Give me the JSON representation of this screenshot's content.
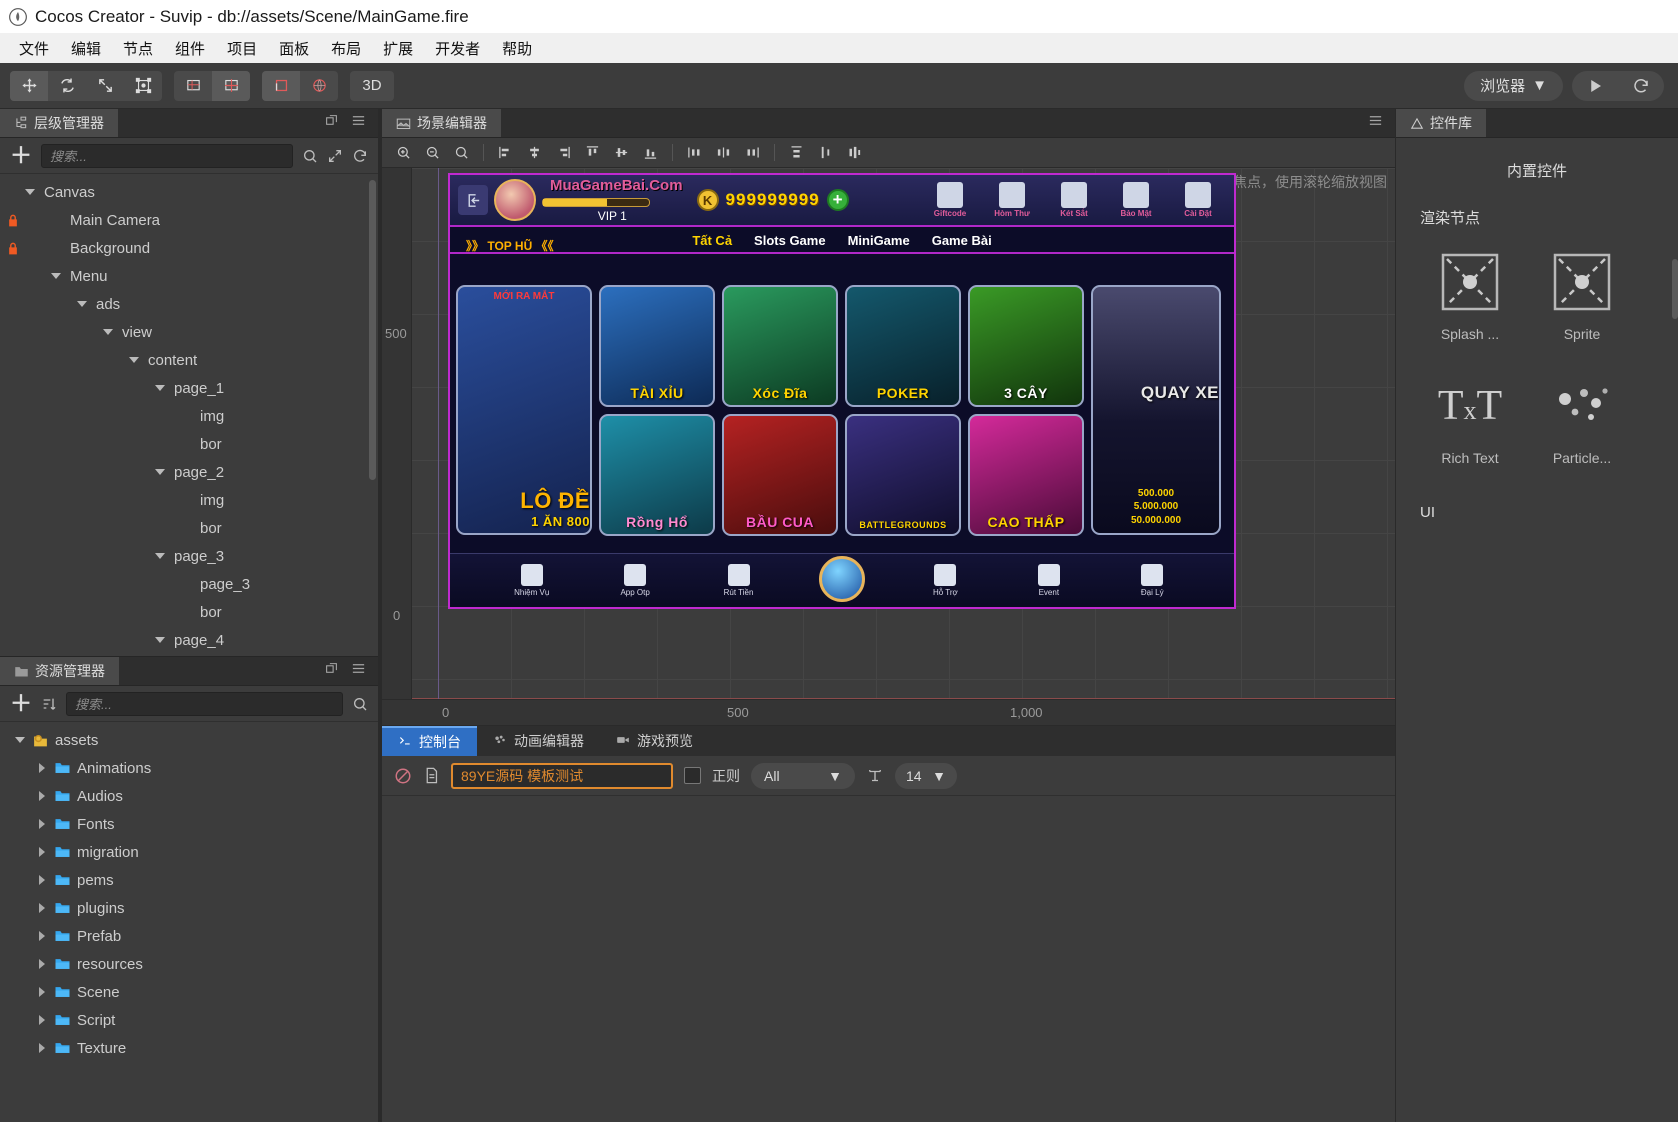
{
  "window": {
    "title": "Cocos Creator - Suvip - db://assets/Scene/MainGame.fire",
    "logo_icon": "cocos-logo-icon"
  },
  "menubar": {
    "items": [
      {
        "label": "文件",
        "name": "menu-file"
      },
      {
        "label": "编辑",
        "name": "menu-edit"
      },
      {
        "label": "节点",
        "name": "menu-node"
      },
      {
        "label": "组件",
        "name": "menu-component"
      },
      {
        "label": "项目",
        "name": "menu-project"
      },
      {
        "label": "面板",
        "name": "menu-panel"
      },
      {
        "label": "布局",
        "name": "menu-layout"
      },
      {
        "label": "扩展",
        "name": "menu-extension"
      },
      {
        "label": "开发者",
        "name": "menu-developer"
      },
      {
        "label": "帮助",
        "name": "menu-help"
      }
    ]
  },
  "toolbar": {
    "transform_tools": [
      "move-tool-icon",
      "rotate-tool-icon",
      "scale-tool-icon",
      "rect-tool-icon"
    ],
    "pivot_tools": [
      "pivot-icon",
      "anchor-icon"
    ],
    "coord_tools": [
      "local-coord-icon",
      "global-coord-icon"
    ],
    "mode_3d_label": "3D",
    "preview_device_label": "浏览器",
    "preview_dropdown_icon": "chevron-down-icon",
    "play_icon": "play-icon",
    "refresh_icon": "refresh-icon"
  },
  "hierarchy": {
    "tab_label": "层级管理器",
    "tab_icon": "hierarchy-icon",
    "search_placeholder": "搜索...",
    "add_icon": "plus-icon",
    "search_icon": "search-icon",
    "expand_icon": "expand-icon",
    "sync_icon": "sync-icon",
    "popout_icon": "popout-icon",
    "menu_icon": "hamburger-icon",
    "nodes": [
      {
        "label": "Canvas",
        "depth": 0,
        "arrow": "down",
        "lock": false
      },
      {
        "label": "Main Camera",
        "depth": 1,
        "arrow": "none",
        "lock": true
      },
      {
        "label": "Background",
        "depth": 1,
        "arrow": "none",
        "lock": true
      },
      {
        "label": "Menu",
        "depth": 1,
        "arrow": "down",
        "lock": false
      },
      {
        "label": "ads",
        "depth": 2,
        "arrow": "down",
        "lock": false
      },
      {
        "label": "view",
        "depth": 3,
        "arrow": "down",
        "lock": false
      },
      {
        "label": "content",
        "depth": 4,
        "arrow": "down",
        "lock": false
      },
      {
        "label": "page_1",
        "depth": 5,
        "arrow": "down",
        "lock": false
      },
      {
        "label": "img",
        "depth": 6,
        "arrow": "none",
        "lock": false
      },
      {
        "label": "bor",
        "depth": 6,
        "arrow": "none",
        "lock": false
      },
      {
        "label": "page_2",
        "depth": 5,
        "arrow": "down",
        "lock": false
      },
      {
        "label": "img",
        "depth": 6,
        "arrow": "none",
        "lock": false
      },
      {
        "label": "bor",
        "depth": 6,
        "arrow": "none",
        "lock": false
      },
      {
        "label": "page_3",
        "depth": 5,
        "arrow": "down",
        "lock": false
      },
      {
        "label": "page_3",
        "depth": 6,
        "arrow": "none",
        "lock": false
      },
      {
        "label": "bor",
        "depth": 6,
        "arrow": "none",
        "lock": false
      },
      {
        "label": "page_4",
        "depth": 5,
        "arrow": "down",
        "lock": false
      }
    ]
  },
  "assets": {
    "tab_label": "资源管理器",
    "tab_icon": "folder-icon",
    "search_placeholder": "搜索...",
    "add_icon": "plus-icon",
    "sort_icon": "sort-icon",
    "search_btn_icon": "search-icon",
    "popout_icon": "popout-icon",
    "menu_icon": "hamburger-icon",
    "items": [
      {
        "label": "assets",
        "depth": 0,
        "arrow": "down",
        "icon": "assets-root-icon"
      },
      {
        "label": "Animations",
        "depth": 1,
        "arrow": "right",
        "icon": "folder-icon"
      },
      {
        "label": "Audios",
        "depth": 1,
        "arrow": "right",
        "icon": "folder-icon"
      },
      {
        "label": "Fonts",
        "depth": 1,
        "arrow": "right",
        "icon": "folder-icon"
      },
      {
        "label": "migration",
        "depth": 1,
        "arrow": "right",
        "icon": "folder-icon"
      },
      {
        "label": "pems",
        "depth": 1,
        "arrow": "right",
        "icon": "folder-icon"
      },
      {
        "label": "plugins",
        "depth": 1,
        "arrow": "right",
        "icon": "folder-icon"
      },
      {
        "label": "Prefab",
        "depth": 1,
        "arrow": "right",
        "icon": "folder-icon"
      },
      {
        "label": "resources",
        "depth": 1,
        "arrow": "right",
        "icon": "folder-icon"
      },
      {
        "label": "Scene",
        "depth": 1,
        "arrow": "right",
        "icon": "folder-icon"
      },
      {
        "label": "Script",
        "depth": 1,
        "arrow": "right",
        "icon": "folder-icon"
      },
      {
        "label": "Texture",
        "depth": 1,
        "arrow": "right",
        "icon": "folder-icon"
      }
    ]
  },
  "scene": {
    "tab_label": "场景编辑器",
    "tab_icon": "scene-icon",
    "menu_icon": "hamburger-icon",
    "hint": "使用鼠标右键平移视窗焦点，使用滚轮缩放视图",
    "tools": [
      "zoom-in-icon",
      "zoom-out-icon",
      "zoom-fit-icon",
      "align-left-icon",
      "align-center-h-icon",
      "align-right-icon",
      "align-top-icon",
      "align-middle-v-icon",
      "align-bottom-icon",
      "distribute-left-icon",
      "distribute-center-icon",
      "distribute-right-icon",
      "distribute-top-icon",
      "distribute-middle-icon",
      "distribute-bottom-icon"
    ],
    "ruler_y": [
      "500",
      "0"
    ],
    "ruler_x": [
      "0",
      "500",
      "1,000"
    ]
  },
  "game": {
    "header": {
      "exit_icon": "exit-icon",
      "avatar": "player-avatar",
      "site_name": "MuaGameBai.Com",
      "vip_label": "VIP 1",
      "coin_icon": "coin-k-icon",
      "coin_value": "999999999",
      "add_coin_icon": "plus-circle-icon",
      "icons": [
        {
          "label": "Giftcode",
          "name": "giftcode-icon"
        },
        {
          "label": "Hòm Thư",
          "name": "mail-icon"
        },
        {
          "label": "Két Sắt",
          "name": "safe-icon"
        },
        {
          "label": "Bảo Mật",
          "name": "security-lock-icon"
        },
        {
          "label": "Cài Đặt",
          "name": "settings-gear-icon"
        }
      ]
    },
    "top_hu_label": "》》 TOP HŨ 《《",
    "category_tabs": [
      {
        "label": "Tất Cả",
        "active": true
      },
      {
        "label": "Slots Game",
        "active": false
      },
      {
        "label": "MiniGame",
        "active": false
      },
      {
        "label": "Game Bài",
        "active": false
      }
    ],
    "featured_tile": {
      "badge": "MỚI RA MẮT",
      "title": "LÔ ĐỀ",
      "subtitle": "1 ĂN 800"
    },
    "tiles_row1": [
      {
        "title": "TÀI XỈU",
        "color": "#1d5fa8"
      },
      {
        "title": "Xóc Đĩa",
        "color": "#1d7a4a"
      },
      {
        "title": "POKER",
        "color": "#12404f"
      },
      {
        "title": "3 CÂY",
        "color": "#2c6f1e"
      }
    ],
    "tiles_row2": [
      {
        "title": "Rồng Hổ",
        "color": "#16708a"
      },
      {
        "title": "BẦU CUA",
        "color": "#9c1f1f"
      },
      {
        "title": "BATTLEGROUNDS",
        "color": "#2a2460"
      },
      {
        "title": "CAO THẤP",
        "color": "#a8197c"
      }
    ],
    "jackpot_tile": {
      "title": "QUAY XE",
      "values": [
        "500.000",
        "5.000.000",
        "50.000.000"
      ]
    },
    "bottom_nav": [
      {
        "label": "Nhiệm Vụ",
        "icon": "task-icon"
      },
      {
        "label": "App Otp",
        "icon": "otp-icon"
      },
      {
        "label": "Rút Tiền",
        "icon": "withdraw-icon"
      },
      {
        "label": "",
        "icon": "home-orb-icon"
      },
      {
        "label": "Hỗ Trợ",
        "icon": "support-icon"
      },
      {
        "label": "Event",
        "icon": "trophy-icon"
      },
      {
        "label": "Đại Lý",
        "icon": "agent-icon"
      }
    ]
  },
  "console": {
    "tabs": [
      {
        "label": "控制台",
        "icon": "console-icon",
        "active": true
      },
      {
        "label": "动画编辑器",
        "icon": "anim-icon",
        "active": false
      },
      {
        "label": "游戏预览",
        "icon": "preview-icon",
        "active": false
      }
    ],
    "clear_icon": "clear-circle-icon",
    "file_icon": "file-icon",
    "filter_value": "89YE源码 模板测试",
    "regex_label": "正则",
    "level_value": "All",
    "level_dropdown_icon": "chevron-down-icon",
    "fontsize_icon": "text-size-icon",
    "fontsize_value": "14",
    "fontsize_dropdown_icon": "chevron-down-icon"
  },
  "widgets": {
    "tab_label": "控件库",
    "tab_icon": "widget-icon",
    "heading": "内置控件",
    "section_render": "渲染节点",
    "section_ui": "UI",
    "items": [
      {
        "label": "Splash ...",
        "icon": "splash-node-icon"
      },
      {
        "label": "Sprite",
        "icon": "sprite-node-icon"
      },
      {
        "label": "Rich Text",
        "icon": "richtext-node-icon"
      },
      {
        "label": "Particle...",
        "icon": "particle-node-icon"
      }
    ]
  }
}
